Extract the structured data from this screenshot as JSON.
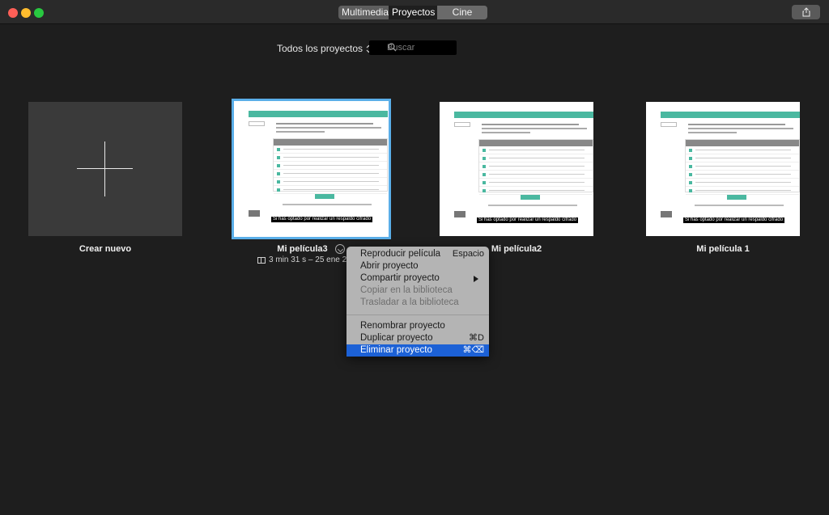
{
  "toolbar": {
    "tabs": [
      {
        "label": "Multimedia",
        "state": "inactive"
      },
      {
        "label": "Proyectos",
        "state": "active"
      },
      {
        "label": "Cine",
        "state": "inactive"
      }
    ],
    "share_icon": "share-icon"
  },
  "filter": {
    "label": "Todos los proyectos",
    "icon": "updown-chevron-icon"
  },
  "search": {
    "placeholder": "Buscar",
    "icon": "search-icon"
  },
  "new_tile": {
    "label": "Crear nuevo",
    "icon": "plus-icon"
  },
  "projects": [
    {
      "name": "Mi película3",
      "meta": "3 min 31 s – 25 ene 20",
      "caption": "Si has optado por realizar un respaldo cifrado",
      "selected": true
    },
    {
      "name": "Mi película2",
      "caption": "Si has optado por realizar un respaldo cifrado",
      "selected": false
    },
    {
      "name": "Mi película 1",
      "caption": "Si has optado por realizar un respaldo cifrado",
      "selected": false
    }
  ],
  "context_menu": {
    "items": [
      {
        "label": "Reproducir película",
        "shortcut": "Espacio",
        "enabled": true
      },
      {
        "label": "Abrir proyecto",
        "shortcut": "",
        "enabled": true
      },
      {
        "label": "Compartir proyecto",
        "shortcut": "",
        "enabled": true,
        "submenu": true
      },
      {
        "label": "Copiar en la biblioteca",
        "shortcut": "",
        "enabled": false
      },
      {
        "label": "Trasladar a la biblioteca",
        "shortcut": "",
        "enabled": false
      },
      {
        "label": "Renombrar proyecto",
        "shortcut": "",
        "enabled": true
      },
      {
        "label": "Duplicar proyecto",
        "shortcut": "⌘D",
        "enabled": true
      },
      {
        "label": "Eliminar proyecto",
        "shortcut": "⌘⌫",
        "enabled": true,
        "highlighted": true
      }
    ]
  },
  "colors": {
    "background": "#1e1e1e",
    "selection": "#5aaee8",
    "menu_highlight": "#1c61d6",
    "thumbnail_accent": "#4ab8a0"
  }
}
